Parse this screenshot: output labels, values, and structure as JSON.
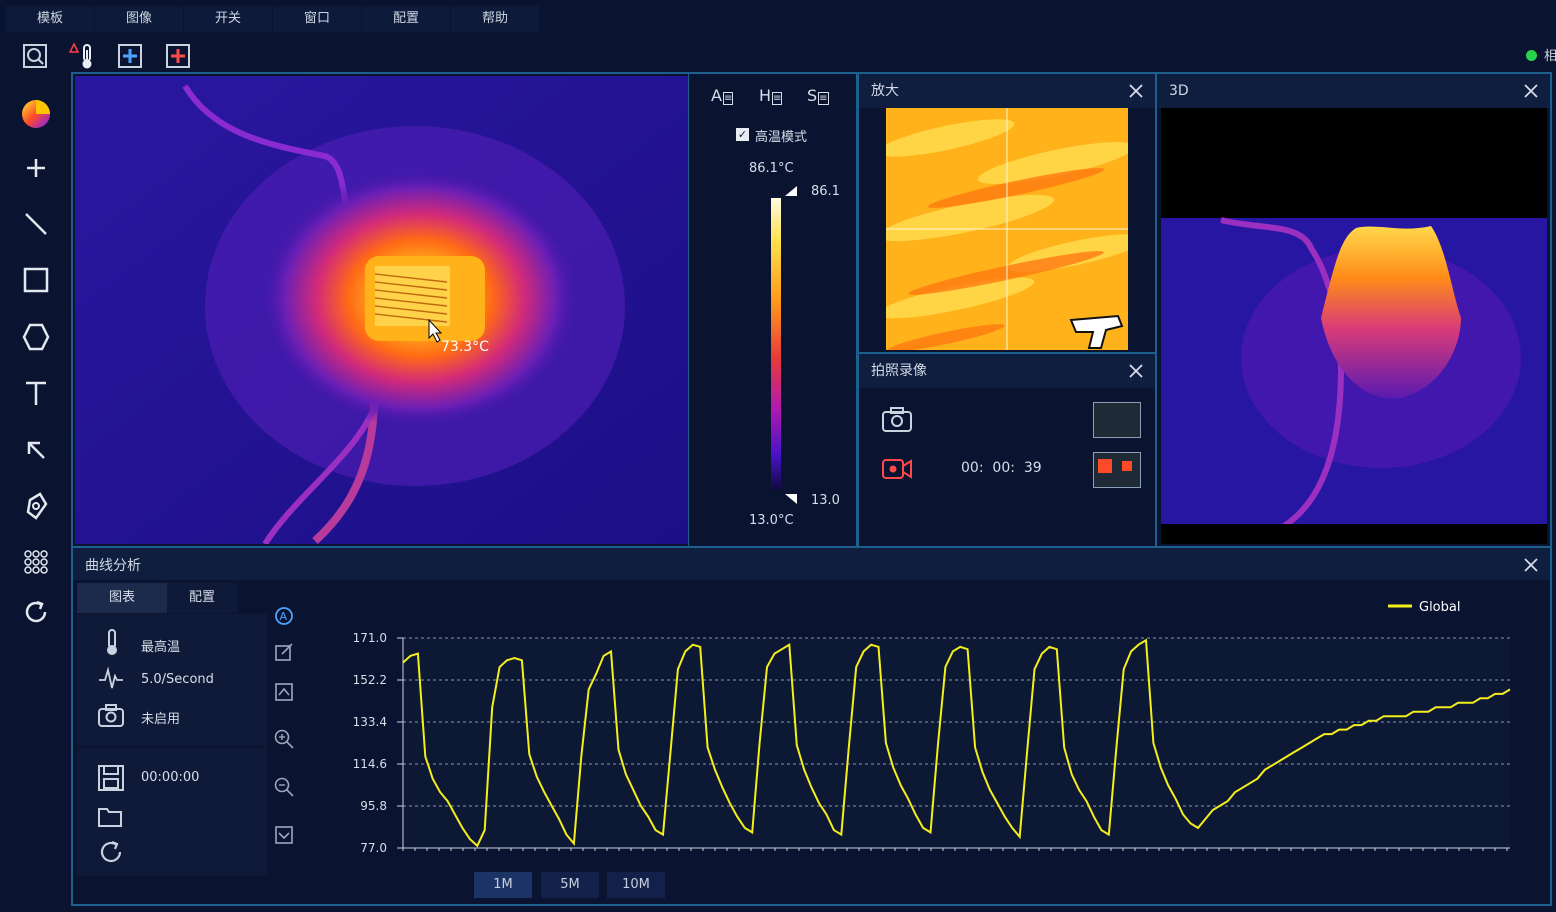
{
  "menu": {
    "items": [
      {
        "label": "模板"
      },
      {
        "label": "图像"
      },
      {
        "label": "开关"
      },
      {
        "label": "窗口"
      },
      {
        "label": "配置"
      },
      {
        "label": "帮助"
      }
    ]
  },
  "status": {
    "cut_label": "相"
  },
  "thermal_view": {
    "cursor_temp": "73.3°C"
  },
  "colorbar": {
    "high_mode_label": "高温模式",
    "max_label": "86.1°C",
    "min_label": "13.0°C",
    "max_tick": "86.1",
    "min_tick": "13.0",
    "mode_buttons": [
      "A",
      "H",
      "S"
    ]
  },
  "zoom_panel": {
    "title": "放大"
  },
  "record_panel": {
    "title": "拍照录像",
    "timer": "00:  00:  39"
  },
  "view3d_panel": {
    "title": "3D"
  },
  "curve_panel": {
    "title": "曲线分析",
    "tabs": [
      "图表",
      "配置"
    ],
    "metric_label": "最高温",
    "rate_label": "5.0/Second",
    "capture_label": "未启用",
    "elapsed": "00:00:00",
    "range_buttons": [
      "1M",
      "5M",
      "10M"
    ]
  },
  "chart_data": {
    "type": "line",
    "title": "",
    "xlabel": "",
    "ylabel": "",
    "ylim": [
      77.0,
      171.0
    ],
    "yticks": [
      "171.0",
      "152.2",
      "133.4",
      "114.6",
      "95.8",
      "77.0"
    ],
    "grid": true,
    "legend_position": "top-right",
    "series": [
      {
        "name": "Global",
        "color": "#f4ee1c",
        "x": [
          0,
          1,
          2,
          3,
          4,
          5,
          6,
          7,
          8,
          9,
          10,
          11,
          12,
          13,
          14,
          15,
          16,
          17,
          18,
          19,
          20,
          21,
          22,
          23,
          24,
          25,
          26,
          27,
          28,
          29,
          30,
          31,
          32,
          33,
          34,
          35,
          36,
          37,
          38,
          39,
          40,
          41,
          42,
          43,
          44,
          45,
          46,
          47,
          48,
          49,
          50,
          51,
          52,
          53,
          54,
          55,
          56,
          57,
          58,
          59,
          60,
          61,
          62,
          63,
          64,
          65,
          66,
          67,
          68,
          69,
          70,
          71,
          72,
          73,
          74,
          75,
          76,
          77,
          78,
          79,
          80,
          81,
          82,
          83,
          84,
          85,
          86,
          87,
          88,
          89,
          90,
          91,
          92,
          93,
          94,
          95,
          96,
          97,
          98,
          99,
          100,
          101,
          102,
          103,
          104,
          105,
          106,
          107,
          108,
          109,
          110,
          111,
          112,
          113,
          114,
          115,
          116,
          117,
          118,
          119,
          120,
          121,
          122,
          123,
          124,
          125,
          126,
          127,
          128,
          129,
          130,
          131,
          132,
          133,
          134,
          135,
          136,
          137,
          138,
          139,
          140,
          141,
          142,
          143,
          144,
          145,
          146,
          147,
          148,
          149
        ],
        "values": [
          160,
          163,
          164,
          118,
          108,
          102,
          98,
          92,
          86,
          81,
          78,
          85,
          140,
          158,
          161,
          162,
          161,
          119,
          109,
          102,
          96,
          90,
          83,
          79,
          118,
          148,
          155,
          163,
          165,
          121,
          110,
          103,
          96,
          91,
          85,
          83,
          120,
          157,
          165,
          168,
          167,
          122,
          112,
          104,
          97,
          91,
          86,
          84,
          124,
          158,
          164,
          166,
          168,
          123,
          112,
          104,
          97,
          92,
          85,
          83,
          122,
          158,
          165,
          168,
          167,
          124,
          113,
          105,
          99,
          92,
          86,
          84,
          123,
          158,
          165,
          167,
          166,
          122,
          111,
          103,
          97,
          91,
          86,
          82,
          120,
          157,
          164,
          167,
          166,
          122,
          110,
          103,
          98,
          91,
          85,
          83,
          121,
          157,
          165,
          168,
          170,
          124,
          113,
          105,
          99,
          92,
          88,
          86,
          90,
          94,
          96,
          98,
          102,
          104,
          106,
          108,
          112,
          114,
          116,
          118,
          120,
          122,
          124,
          126,
          128,
          128,
          130,
          130,
          132,
          132,
          134,
          134,
          136,
          136,
          136,
          136,
          138,
          138,
          138,
          140,
          140,
          140,
          142,
          142,
          142,
          144,
          144,
          146,
          146,
          148
        ]
      }
    ]
  }
}
